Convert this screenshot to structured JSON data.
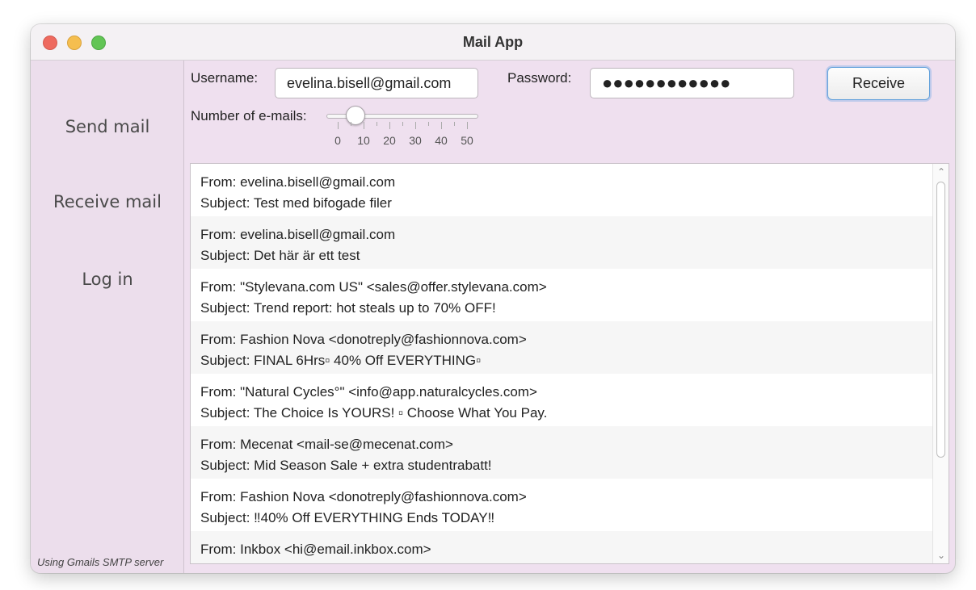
{
  "window": {
    "title": "Mail App"
  },
  "sidebar": {
    "items": [
      {
        "label": "Send mail"
      },
      {
        "label": "Receive mail"
      },
      {
        "label": "Log in"
      }
    ],
    "footer": "Using Gmails SMTP server"
  },
  "form": {
    "username_label": "Username:",
    "username_value": "evelina.bisell@gmail.com",
    "password_label": "Password:",
    "password_value": "●●●●●●●●●●●●",
    "receive_label": "Receive",
    "count_label": "Number of e-mails:",
    "slider": {
      "min": 0,
      "max": 50,
      "value": 7,
      "tick_labels": [
        "0",
        "10",
        "20",
        "30",
        "40",
        "50"
      ]
    }
  },
  "emails": [
    {
      "from": "From: evelina.bisell@gmail.com",
      "subject": "Subject: Test med bifogade filer"
    },
    {
      "from": "From: evelina.bisell@gmail.com",
      "subject": "Subject: Det här är ett test"
    },
    {
      "from": "From: \"Stylevana.com US\" <sales@offer.stylevana.com>",
      "subject": "Subject: Trend report: hot steals up to 70% OFF!"
    },
    {
      "from": "From: Fashion Nova <donotreply@fashionnova.com>",
      "subject": "Subject: FINAL 6Hrs▫ 40% Off EVERYTHING▫"
    },
    {
      "from": "From: \"Natural Cycles°\" <info@app.naturalcycles.com>",
      "subject": "Subject: The Choice Is YOURS! ▫ Choose What You Pay."
    },
    {
      "from": "From: Mecenat <mail-se@mecenat.com>",
      "subject": "Subject: Mid Season Sale + extra studentrabatt!"
    },
    {
      "from": "From: Fashion Nova <donotreply@fashionnova.com>",
      "subject": "Subject: ‼40% Off EVERYTHING Ends TODAY‼"
    },
    {
      "from": "From: Inkbox <hi@email.inkbox.com>",
      "subject": ""
    }
  ]
}
